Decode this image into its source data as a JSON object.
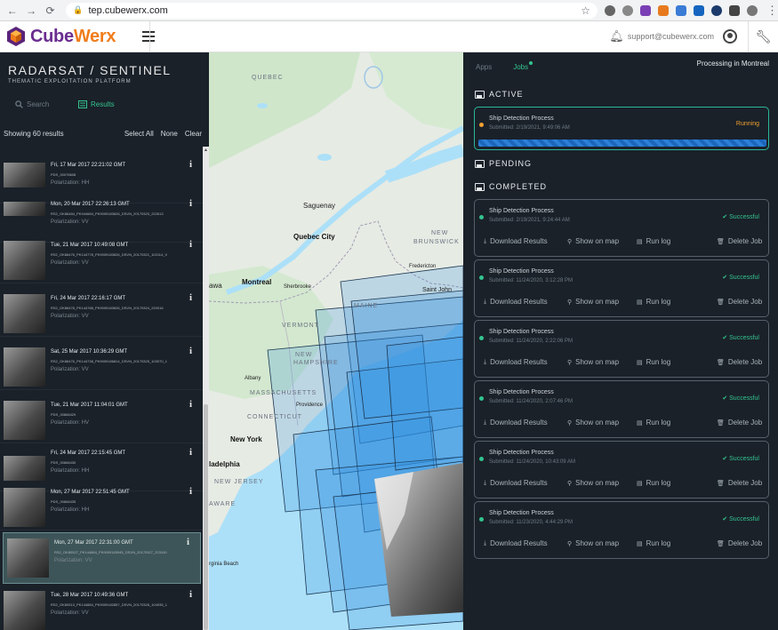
{
  "browser": {
    "url": "tep.cubewerx.com"
  },
  "header": {
    "logo_part1": "Cube",
    "logo_part2": "Werx",
    "email": "support@cubewerx.com"
  },
  "sidebar": {
    "title": "RADARSAT / SENTINEL",
    "subtitle": "THEMATIC EXPLOITATION PLATFORM",
    "tab_search": "Search",
    "tab_results": "Results",
    "showing": "Showing 60 results",
    "select_all": "Select All",
    "none": "None",
    "clear": "Clear",
    "results": [
      {
        "date": "Fri, 17 Mar 2017 22:21:02 GMT",
        "id": "PDS_00078608",
        "pol": "Polarization: HH"
      },
      {
        "date": "Mon, 20 Mar 2017 22:26:13 GMT",
        "id": "RS2_OK86484_PK944684_PK9009183626_DSVN_20170320_222613",
        "pol": "Polarization: VV"
      },
      {
        "date": "Tue, 21 Mar 2017 10:49:08 GMT",
        "id": "RS2_OK86476_PK144778_PK9009183626_DSVN_20170321_102114_V",
        "pol": "Polarization: VV"
      },
      {
        "date": "Fri, 24 Mar 2017 22:16:17 GMT",
        "id": "RS2_OK86478_PK144788_PK9009183626_DSVN_20170324_220016",
        "pol": "Polarization: VV"
      },
      {
        "date": "Sat, 25 Mar 2017 10:36:29 GMT",
        "id": "RS2_OK86476_PK144738_PK9009186814_DSVN_20170325_103070_1",
        "pol": "Polarization: VV"
      },
      {
        "date": "Tue, 21 Mar 2017 11:04:01 GMT",
        "id": "PDS_00868429",
        "pol": "Polarization: HV"
      },
      {
        "date": "Fri, 24 Mar 2017 22:15:45 GMT",
        "id": "PDS_00868430",
        "pol": "Polarization: HH"
      },
      {
        "date": "Mon, 27 Mar 2017 22:51:45 GMT",
        "id": "PDS_00868435",
        "pol": "Polarization: HH"
      },
      {
        "date": "Mon, 27 Mar 2017 22:31:00 GMT",
        "id": "RS2_OK80527_PK144884_PK9009183945_DSVN_20170327_223100",
        "pol": "Polarization: VV"
      },
      {
        "date": "Tue, 28 Mar 2017 10:49:36 GMT",
        "id": "RS2_OK80513_PK144884_PK9009182857_DSVN_20170328_104935_1",
        "pol": "Polarization: VV"
      }
    ]
  },
  "map": {
    "labels": {
      "quebec": "QUEBEC",
      "saguenay": "Saguenay",
      "quebec_city": "Quebec City",
      "new_brunswick_1": "NEW",
      "new_brunswick_2": "BRUNSWICK",
      "fredericton": "Fredericton",
      "saint_john": "Saint John",
      "ottawa": "awa",
      "montreal": "Montreal",
      "sherbrooke": "Sherbrooke",
      "maine": "MAINE",
      "vermont": "VERMONT",
      "new_hampshire_1": "NEW",
      "new_hampshire_2": "HAMPSHIRE",
      "albany": "Albany",
      "massachusetts": "MASSACHUSETTS",
      "providence": "Providence",
      "connecticut": "CONNECTICUT",
      "new_york": "New York",
      "philadelphia": "ladelphia",
      "new_jersey": "NEW JERSEY",
      "delaware": "AWARE",
      "virginia_beach": "rginia Beach"
    }
  },
  "jobs": {
    "tab_apps": "Apps",
    "tab_jobs": "Jobs",
    "processing": "Processing in Montreal",
    "section_active": "ACTIVE",
    "section_pending": "PENDING",
    "section_completed": "COMPLETED",
    "active_job": {
      "title": "Ship Detection Process",
      "submitted": "Submitted: 2/19/2021, 9:49:06 AM",
      "status": "Running",
      "progress": 1.0
    },
    "action_download": "Download Results",
    "action_map": "Show on map",
    "action_log": "Run log",
    "action_delete": "Delete Job",
    "completed": [
      {
        "title": "Ship Detection Process",
        "submitted": "Submitted: 2/19/2021, 9:24:44 AM",
        "status": "Successful"
      },
      {
        "title": "Ship Detection Process",
        "submitted": "Submitted: 11/24/2020, 3:12:28 PM",
        "status": "Successful"
      },
      {
        "title": "Ship Detection Process",
        "submitted": "Submitted: 11/24/2020, 2:22:06 PM",
        "status": "Successful"
      },
      {
        "title": "Ship Detection Process",
        "submitted": "Submitted: 11/24/2020, 2:07:46 PM",
        "status": "Successful"
      },
      {
        "title": "Ship Detection Process",
        "submitted": "Submitted: 11/24/2020, 10:43:09 AM",
        "status": "Successful"
      },
      {
        "title": "Ship Detection Process",
        "submitted": "Submitted: 11/23/2020, 4:44:29 PM",
        "status": "Successful"
      }
    ]
  },
  "colors": {
    "accent_green": "#34c38f",
    "running_orange": "#f0a030",
    "panel_bg": "#1a2129",
    "brand_purple": "#6b2d8f",
    "brand_orange": "#f07c1b"
  }
}
